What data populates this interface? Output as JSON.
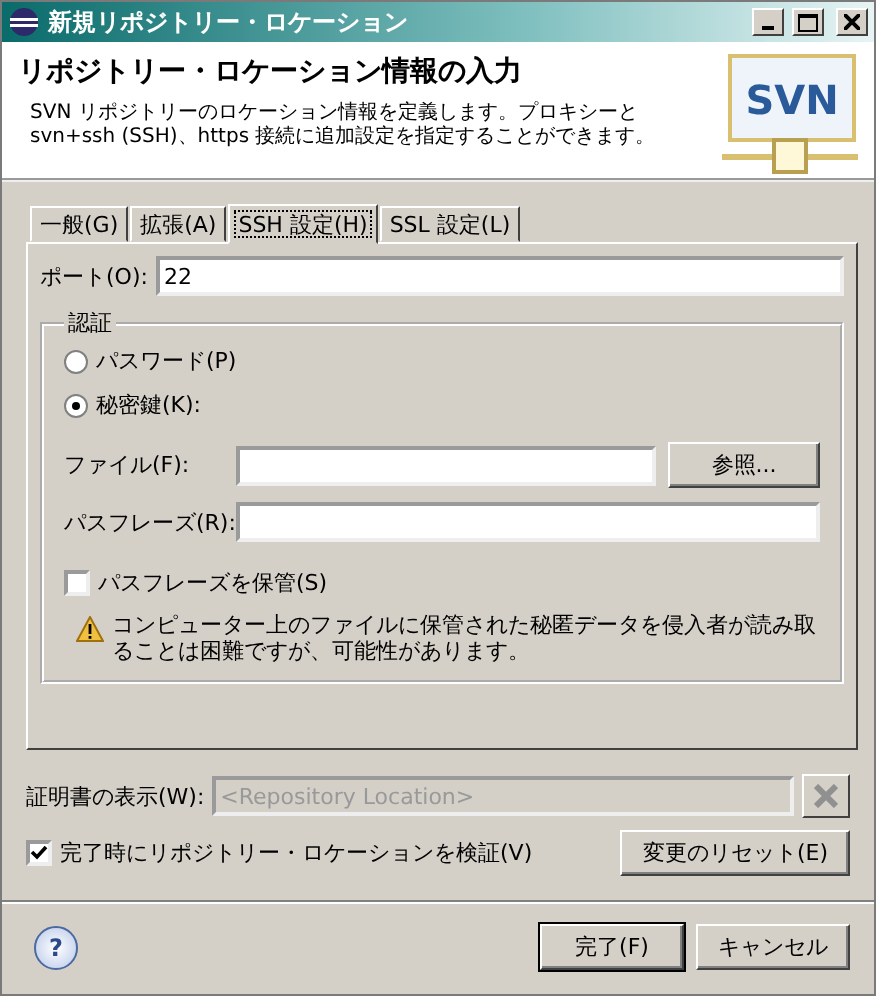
{
  "window": {
    "title": "新規リポジトリー・ロケーション"
  },
  "header": {
    "title": "リポジトリー・ロケーション情報の入力",
    "description": "SVN リポジトリーのロケーション情報を定義します。プロキシーと svn+ssh (SSH)、https 接続に追加設定を指定することができます。",
    "logo": "SVN"
  },
  "tabs": [
    {
      "label": "一般(G)",
      "selected": false
    },
    {
      "label": "拡張(A)",
      "selected": false
    },
    {
      "label": "SSH 設定(H)",
      "selected": true
    },
    {
      "label": "SSL 設定(L)",
      "selected": false
    }
  ],
  "port": {
    "label": "ポート(O):",
    "value": "22"
  },
  "auth": {
    "title": "認証",
    "options": [
      {
        "label": "パスワード(P)",
        "selected": false
      },
      {
        "label": "秘密鍵(K):",
        "selected": true
      }
    ],
    "file": {
      "label": "ファイル(F):",
      "button": "参照..."
    },
    "passphrase": {
      "label": "パスフレーズ(R):"
    },
    "save_passphrase": {
      "label": "パスフレーズを保管(S)",
      "checked": false
    },
    "warning": "コンピューター上のファイルに保管された秘匿データを侵入者が読み取ることは困難ですが、可能性があります。"
  },
  "certificate": {
    "label": "証明書の表示(W):",
    "placeholder": "<Repository Location>",
    "disabled": true
  },
  "validate": {
    "label": "完了時にリポジトリー・ロケーションを検証(V)",
    "checked": true
  },
  "reset_button": "変更のリセット(E)",
  "help": "?",
  "buttons": [
    "完了(F)",
    "キャンセル"
  ]
}
